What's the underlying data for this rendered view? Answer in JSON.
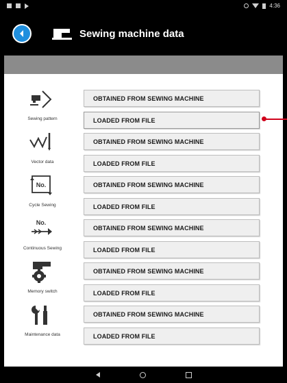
{
  "statusbar": {
    "time": "4:36"
  },
  "header": {
    "title": "Sewing machine data",
    "back_icon": "back-arrow-icon",
    "title_icon": "sewing-machine-icon"
  },
  "colors": {
    "accent": "#1f8fde",
    "marker": "#d0021b",
    "header_bg": "#000000",
    "subheader_bg": "#8b8b8b",
    "button_bg": "#efefef"
  },
  "rows": [
    {
      "label": "Sewing pattern",
      "icon": "sewing-pattern-icon",
      "btn1": "OBTAINED FROM SEWING MACHINE",
      "btn2": "LOADED FROM FILE"
    },
    {
      "label": "Vector data",
      "icon": "vector-data-icon",
      "btn1": "OBTAINED FROM SEWING MACHINE",
      "btn2": "LOADED FROM FILE"
    },
    {
      "label": "Cycle Sewing",
      "icon": "cycle-sewing-icon",
      "btn1": "OBTAINED FROM SEWING MACHINE",
      "btn2": "LOADED FROM FILE"
    },
    {
      "label": "Continuous Sewing",
      "icon": "continuous-sewing-icon",
      "btn1": "OBTAINED FROM SEWING MACHINE",
      "btn2": "LOADED FROM FILE"
    },
    {
      "label": "Memory switch",
      "icon": "memory-switch-icon",
      "btn1": "OBTAINED FROM SEWING MACHINE",
      "btn2": "LOADED FROM FILE"
    },
    {
      "label": "Maintenance data",
      "icon": "maintenance-data-icon",
      "btn1": "OBTAINED FROM SEWING MACHINE",
      "btn2": "LOADED FROM FILE"
    }
  ],
  "icons_text": {
    "cycle": "No.",
    "continuous": "No."
  }
}
